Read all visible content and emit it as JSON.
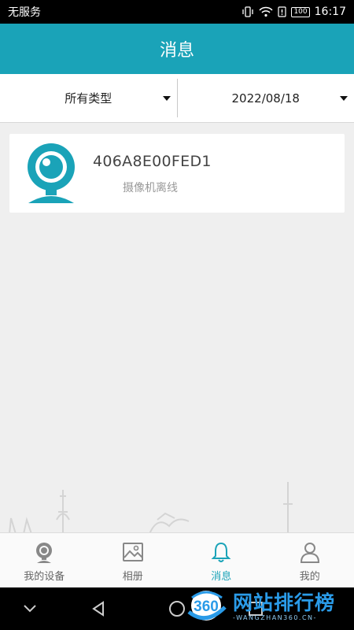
{
  "status_bar": {
    "carrier": "无服务",
    "battery": "100",
    "time": "16:17"
  },
  "header": {
    "title": "消息"
  },
  "filters": {
    "type_label": "所有类型",
    "date_label": "2022/08/18"
  },
  "messages": [
    {
      "device_id": "406A8E00FED1",
      "status_text": "摄像机离线",
      "icon": "camera-icon"
    }
  ],
  "tabs": [
    {
      "label": "我的设备",
      "icon": "device-icon",
      "active": false
    },
    {
      "label": "相册",
      "icon": "album-icon",
      "active": false
    },
    {
      "label": "消息",
      "icon": "bell-icon",
      "active": true
    },
    {
      "label": "我的",
      "icon": "user-icon",
      "active": false
    }
  ],
  "watermark": {
    "number": "360",
    "cn": "网站排行榜",
    "en": "-WANGZHAN360.CN-"
  },
  "colors": {
    "accent": "#1aa3b8",
    "watermark": "#2a9be8"
  }
}
